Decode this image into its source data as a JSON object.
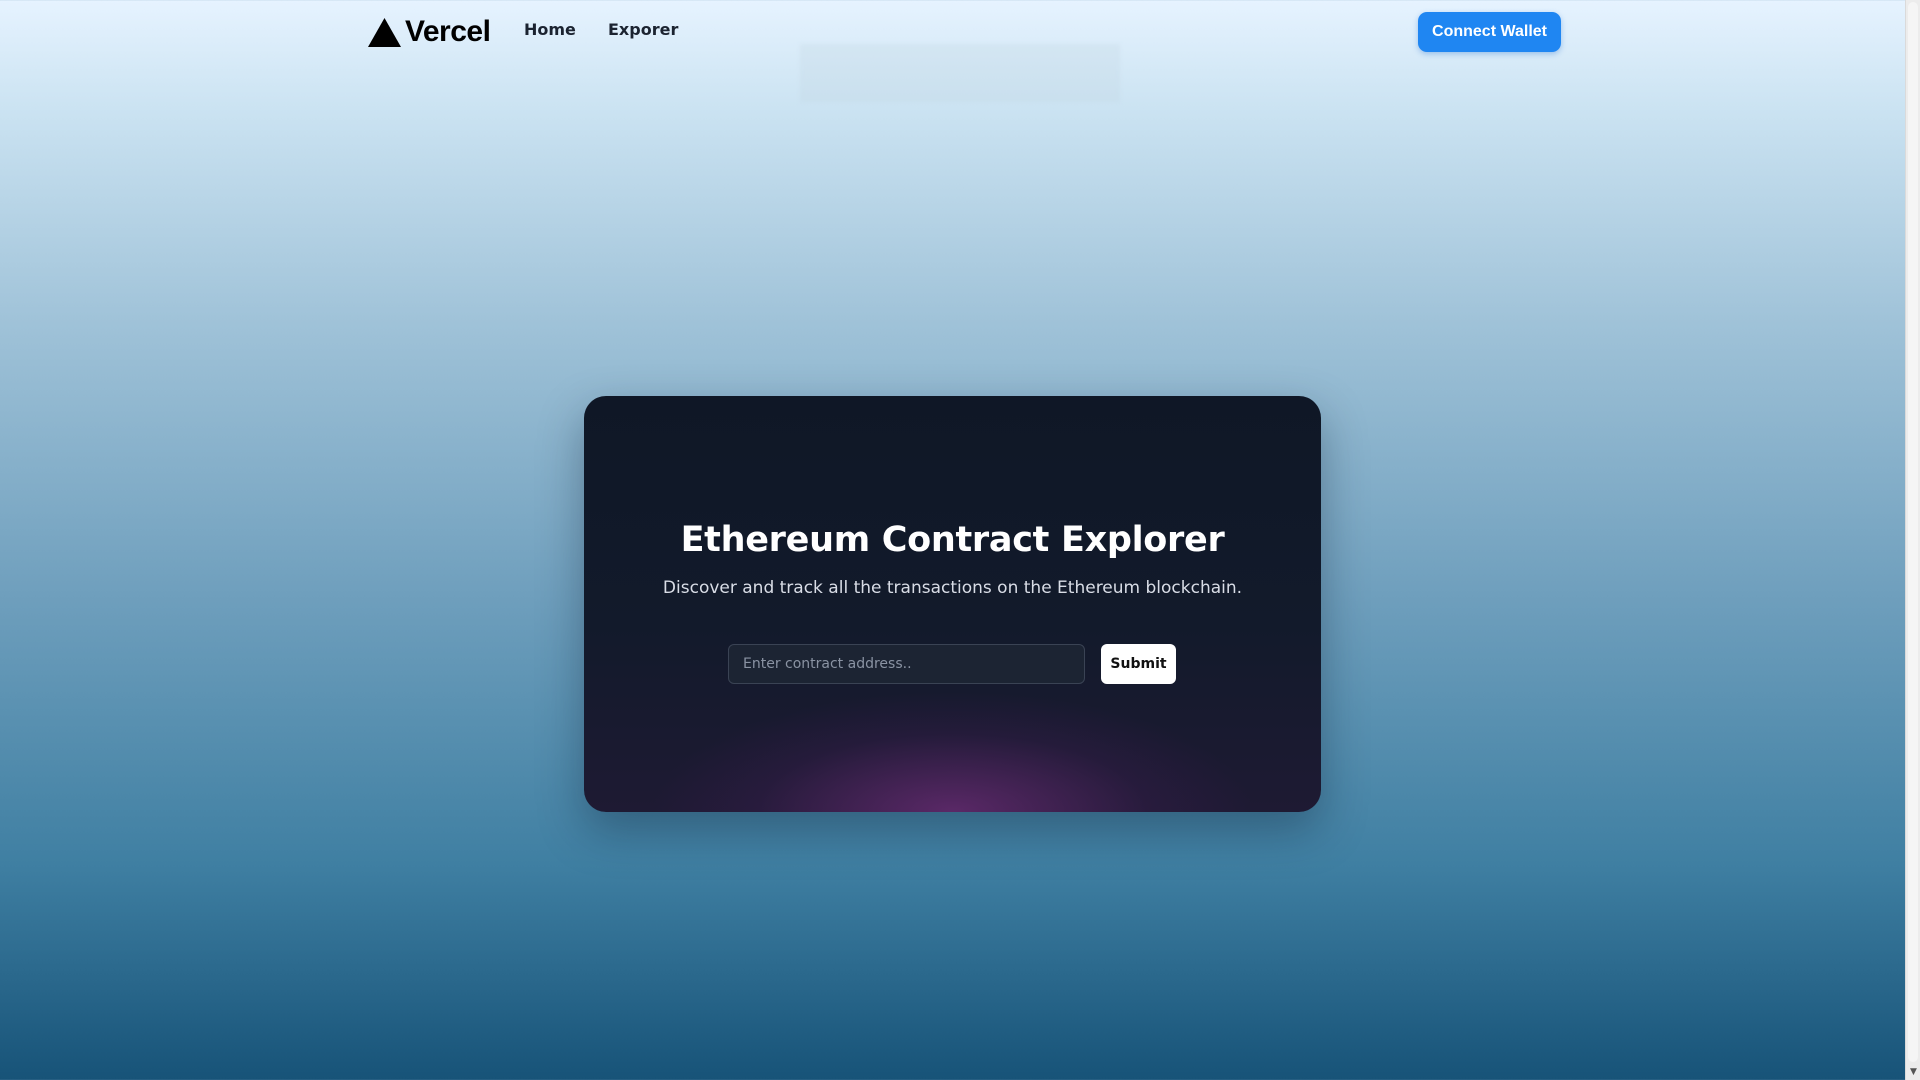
{
  "header": {
    "brand": {
      "name": "Vercel",
      "icon": "triangle-logo-icon"
    },
    "nav": [
      {
        "label": "Home"
      },
      {
        "label": "Exporer"
      }
    ],
    "connect_button_label": "Connect Wallet"
  },
  "hero": {
    "title": "Ethereum Contract Explorer",
    "subtitle": "Discover and track all the transactions on the Ethereum blockchain.",
    "search": {
      "placeholder": "Enter contract address..",
      "value": ""
    },
    "submit_label": "Submit"
  },
  "colors": {
    "accent": "#1f86f2",
    "card_background": "#121a2b",
    "page_gradient_top": "#e6f3ff",
    "page_gradient_bottom": "#175378"
  },
  "scrollbar": {
    "up_icon": "scroll-up-arrow-icon",
    "down_icon": "scroll-down-arrow-icon"
  }
}
